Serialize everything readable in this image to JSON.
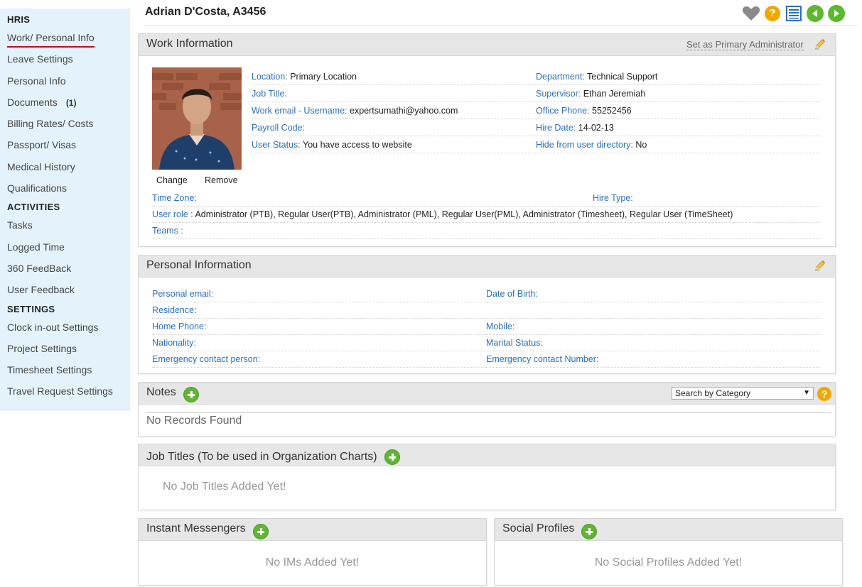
{
  "sidebar": {
    "sections": [
      {
        "heading": "HRIS",
        "items": [
          {
            "label": "Work/ Personal Info",
            "active": true
          },
          {
            "label": "Leave Settings"
          },
          {
            "label": "Personal Info"
          },
          {
            "label": "Documents",
            "count": "(1)"
          },
          {
            "label": "Billing Rates/ Costs"
          },
          {
            "label": "Passport/ Visas"
          },
          {
            "label": "Medical History"
          },
          {
            "label": "Qualifications"
          }
        ]
      },
      {
        "heading": "ACTIVITIES",
        "items": [
          {
            "label": "Tasks"
          },
          {
            "label": "Logged Time"
          },
          {
            "label": "360 FeedBack"
          },
          {
            "label": "User Feedback"
          }
        ]
      },
      {
        "heading": "SETTINGS",
        "items": [
          {
            "label": "Clock in-out Settings"
          },
          {
            "label": "Project Settings"
          },
          {
            "label": "Timesheet Settings"
          },
          {
            "label": "Travel Request Settings"
          }
        ]
      }
    ]
  },
  "header": {
    "title": "Adrian D'Costa, A3456",
    "icons": [
      "heart-icon",
      "help-icon",
      "list-icon",
      "previous-icon",
      "next-icon"
    ]
  },
  "work": {
    "title": "Work Information",
    "set_primary": "Set as Primary Administrator",
    "change": "Change",
    "remove": "Remove",
    "left_fields": [
      {
        "label": "Location:",
        "value": "Primary Location"
      },
      {
        "label": "Job Title:",
        "value": ""
      },
      {
        "label": "Work email - Username:",
        "value": "expertsumathi@yahoo.com"
      },
      {
        "label": "Payroll Code:",
        "value": ""
      },
      {
        "label": "User Status:",
        "value": "You have access to website"
      }
    ],
    "right_fields": [
      {
        "label": "Department:",
        "value": "Technical Support"
      },
      {
        "label": "Supervisor:",
        "value": "Ethan Jeremiah"
      },
      {
        "label": "Office Phone:",
        "value": "55252456"
      },
      {
        "label": "Hire Date:",
        "value": "14-02-13"
      },
      {
        "label": "Hide from user directory:",
        "value": "No"
      }
    ],
    "time_zone": {
      "label": "Time Zone:",
      "value": ""
    },
    "hire_type": {
      "label": "Hire Type:",
      "value": ""
    },
    "user_role": {
      "label": "User role :",
      "value": "Administrator (PTB), Regular User(PTB), Administrator (PML), Regular User(PML), Administrator (Timesheet), Regular User (TimeSheet)"
    },
    "teams": {
      "label": "Teams :",
      "value": ""
    }
  },
  "personal": {
    "title": "Personal Information",
    "rows": [
      {
        "left": "Personal email:",
        "right": "Date of Birth:"
      },
      {
        "left": "Residence:",
        "right": ""
      },
      {
        "left": "Home Phone:",
        "right": "Mobile:"
      },
      {
        "left": "Nationality:",
        "right": "Marital Status:"
      },
      {
        "left": "Emergency contact person:",
        "right": "Emergency contact Number:"
      }
    ]
  },
  "notes": {
    "title": "Notes",
    "search_placeholder": "Search by Category",
    "empty": "No Records Found"
  },
  "job_titles": {
    "title": "Job Titles (To be used in Organization Charts)",
    "empty": "No Job Titles Added Yet!"
  },
  "ims": {
    "title": "Instant Messengers",
    "empty": "No IMs Added Yet!"
  },
  "social": {
    "title": "Social Profiles",
    "empty": "No Social Profiles Added Yet!"
  },
  "colors": {
    "sidebar_bg": "#e4f3fb",
    "label_blue": "#2a6fb9",
    "active_underline": "#d9001b",
    "add_green": "#62b434",
    "help_orange": "#f0a800"
  }
}
